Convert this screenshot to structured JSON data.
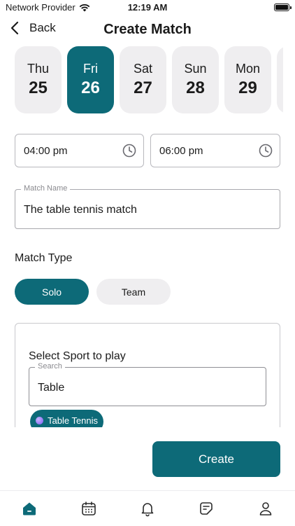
{
  "status_bar": {
    "carrier": "Network Provider",
    "time": "12:19 AM",
    "battery_level": 1.0
  },
  "header": {
    "back_label": "Back",
    "title": "Create Match"
  },
  "dates": [
    {
      "dow": "Thu",
      "day": "25",
      "selected": false
    },
    {
      "dow": "Fri",
      "day": "26",
      "selected": true
    },
    {
      "dow": "Sat",
      "day": "27",
      "selected": false
    },
    {
      "dow": "Sun",
      "day": "28",
      "selected": false
    },
    {
      "dow": "Mon",
      "day": "29",
      "selected": false
    },
    {
      "dow": "",
      "day": "",
      "selected": false
    }
  ],
  "time": {
    "start": "04:00 pm",
    "end": "06:00 pm"
  },
  "match_name": {
    "label": "Match Name",
    "value": "The table tennis match"
  },
  "match_type": {
    "label": "Match Type",
    "options": [
      "Solo",
      "Team"
    ],
    "selected": "Solo"
  },
  "sport": {
    "title": "Select Sport to play",
    "search_label": "Search",
    "search_value": "Table",
    "chip_label": "Table Tennis"
  },
  "actions": {
    "create": "Create"
  },
  "nav": {
    "items": [
      "home-icon",
      "calendar-icon",
      "bell-icon",
      "notes-icon",
      "profile-icon"
    ],
    "active": "home-icon"
  },
  "colors": {
    "accent": "#0d6a78",
    "pill_bg": "#efeef0"
  }
}
